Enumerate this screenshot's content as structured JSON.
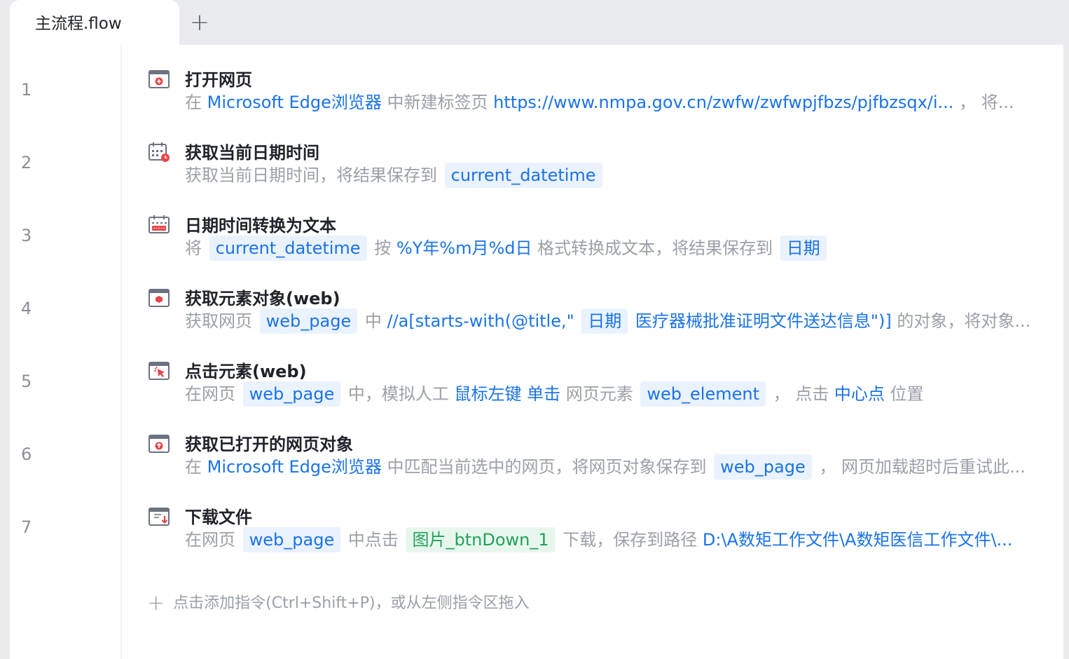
{
  "tabs": [
    {
      "label": "主流程.flow"
    }
  ],
  "tab_add_label": "+",
  "line_numbers": [
    "1",
    "2",
    "3",
    "4",
    "5",
    "6",
    "7"
  ],
  "steps": [
    {
      "icon": "open-webpage-icon",
      "title": "打开网页",
      "desc": [
        {
          "t": "在 ",
          "s": "g"
        },
        {
          "t": "Microsoft Edge浏览器",
          "s": "b"
        },
        {
          "t": " 中新建标签页 ",
          "s": "g"
        },
        {
          "t": "https://www.nmpa.gov.cn/zwfw/zwfwpjfbzs/pjfbzsqx/i...",
          "s": "b"
        },
        {
          "t": " ， 将...",
          "s": "g"
        }
      ]
    },
    {
      "icon": "calendar-clock-icon",
      "title": "获取当前日期时间",
      "desc": [
        {
          "t": "获取当前日期时间，将结果保存到 ",
          "s": "g"
        },
        {
          "t": "current_datetime",
          "s": "chip"
        }
      ]
    },
    {
      "icon": "calendar-text-icon",
      "title": "日期时间转换为文本",
      "desc": [
        {
          "t": "将 ",
          "s": "g"
        },
        {
          "t": "current_datetime",
          "s": "chip"
        },
        {
          "t": " 按 ",
          "s": "g"
        },
        {
          "t": "%Y年%m月%d日",
          "s": "b"
        },
        {
          "t": " 格式转换成文本，将结果保存到 ",
          "s": "g"
        },
        {
          "t": "日期",
          "s": "chip"
        }
      ]
    },
    {
      "icon": "web-element-icon",
      "title": "获取元素对象(web)",
      "desc": [
        {
          "t": "获取网页 ",
          "s": "g"
        },
        {
          "t": "web_page",
          "s": "chip"
        },
        {
          "t": " 中 ",
          "s": "g"
        },
        {
          "t": "//a[starts-with(@title,\" ",
          "s": "b"
        },
        {
          "t": "日期",
          "s": "chip"
        },
        {
          "t": " 医疗器械批准证明文件送达信息\")]",
          "s": "b"
        },
        {
          "t": " 的对象，将对象...",
          "s": "g"
        }
      ]
    },
    {
      "icon": "click-element-icon",
      "title": "点击元素(web)",
      "desc": [
        {
          "t": "在网页 ",
          "s": "g"
        },
        {
          "t": "web_page",
          "s": "chip"
        },
        {
          "t": " 中，模拟人工 ",
          "s": "g"
        },
        {
          "t": "鼠标左键",
          "s": "b"
        },
        {
          "t": " ",
          "s": "g"
        },
        {
          "t": "单击",
          "s": "b"
        },
        {
          "t": " 网页元素 ",
          "s": "g"
        },
        {
          "t": "web_element",
          "s": "chip"
        },
        {
          "t": " ， 点击 ",
          "s": "g"
        },
        {
          "t": "中心点",
          "s": "b"
        },
        {
          "t": " 位置",
          "s": "g"
        }
      ]
    },
    {
      "icon": "get-opened-webpage-icon",
      "title": "获取已打开的网页对象",
      "desc": [
        {
          "t": "在 ",
          "s": "g"
        },
        {
          "t": "Microsoft Edge浏览器",
          "s": "b"
        },
        {
          "t": " 中匹配当前选中的网页，将网页对象保存到 ",
          "s": "g"
        },
        {
          "t": "web_page",
          "s": "chip"
        },
        {
          "t": " ， 网页加载超时后重试此...",
          "s": "g"
        }
      ]
    },
    {
      "icon": "download-file-icon",
      "title": "下载文件",
      "desc": [
        {
          "t": "在网页 ",
          "s": "g"
        },
        {
          "t": "web_page",
          "s": "chip"
        },
        {
          "t": " 中点击 ",
          "s": "g"
        },
        {
          "t": "图片_btnDown_1",
          "s": "chip-green"
        },
        {
          "t": " 下载，保存到路径 ",
          "s": "g"
        },
        {
          "t": "D:\\A数矩工作文件\\A数矩医信工作文件\\...",
          "s": "b"
        }
      ]
    }
  ],
  "add_instruction": {
    "icon": "plus-icon",
    "label": "点击添加指令(Ctrl+Shift+P)，或从左侧指令区拖入"
  },
  "colors": {
    "accent": "#1a73e8",
    "chip_bg": "#eaf2fe",
    "green": "#22a35a",
    "icon_red": "#e8464b"
  }
}
